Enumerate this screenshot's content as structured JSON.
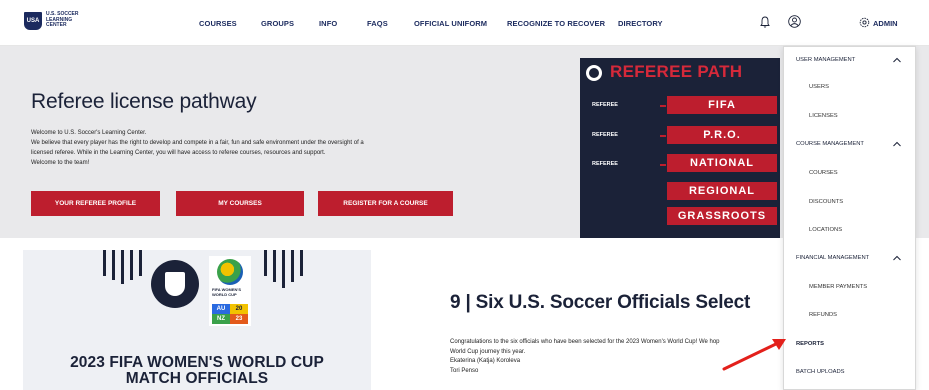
{
  "nav": {
    "logo_text": "U.S. SOCCER LEARNING CENTER",
    "logo_shield": "USA",
    "links": [
      {
        "label": "COURSES"
      },
      {
        "label": "GROUPS"
      },
      {
        "label": "INFO"
      },
      {
        "label": "FAQS"
      },
      {
        "label": "OFFICIAL UNIFORM"
      },
      {
        "label": "RECOGNIZE TO RECOVER"
      },
      {
        "label": "DIRECTORY"
      }
    ],
    "admin_label": "ADMIN",
    "icons": [
      "bell-icon",
      "user-icon",
      "gear-icon"
    ]
  },
  "hero": {
    "title": "Referee license pathway",
    "text_lines": [
      "Welcome to U.S. Soccer's Learning Center.",
      "We believe that every player has the right to develop and compete in a fair, fun and safe environment under the oversight of a",
      "licensed referee. While in the Learning Center, you will have access to referee courses, resources and support.",
      "Welcome to the team!"
    ],
    "buttons": [
      {
        "label": "YOUR REFEREE PROFILE"
      },
      {
        "label": "MY COURSES"
      },
      {
        "label": "REGISTER FOR A COURSE"
      }
    ]
  },
  "pathway": {
    "heading": "REFEREE PATH",
    "rows": [
      {
        "label": "REFEREE",
        "level": "FIFA"
      },
      {
        "label": "REFEREE",
        "level": "P.R.O."
      },
      {
        "label": "REFEREE",
        "level": "NATIONAL"
      },
      {
        "label": "",
        "level": "REGIONAL"
      },
      {
        "label": "",
        "level": "GRASSROOTS"
      }
    ]
  },
  "dropdown": {
    "items": [
      {
        "label": "USER MANAGEMENT",
        "type": "section"
      },
      {
        "label": "USERS",
        "type": "sub"
      },
      {
        "label": "LICENSES",
        "type": "sub"
      },
      {
        "label": "COURSE MANAGEMENT",
        "type": "section"
      },
      {
        "label": "COURSES",
        "type": "sub"
      },
      {
        "label": "DISCOUNTS",
        "type": "sub"
      },
      {
        "label": "LOCATIONS",
        "type": "sub"
      },
      {
        "label": "FINANCIAL MANAGEMENT",
        "type": "section"
      },
      {
        "label": "MEMBER PAYMENTS",
        "type": "sub"
      },
      {
        "label": "REFUNDS",
        "type": "sub"
      },
      {
        "label": "REPORTS",
        "type": "highlight"
      },
      {
        "label": "BATCH UPLOADS",
        "type": "sub"
      }
    ]
  },
  "promo": {
    "title_line1": "2023 FIFA WOMEN'S WORLD CUP",
    "title_line2": "MATCH OFFICIALS",
    "wc_fifa": "FIFA WOMEN'S WORLD CUP",
    "wc_au": "AU",
    "wc_nz": "NZ",
    "wc_20": "20",
    "wc_23": "23"
  },
  "article": {
    "title": "9 | Six U.S. Soccer Officials Select",
    "lines": [
      "Congratulations to the six officials who have been selected for the 2023 Women's World Cup! We hop",
      "World Cup journey this year.",
      "Ekaterina (Katja) Koroleva",
      "Tori Penso"
    ]
  },
  "colors": {
    "brand_navy": "#1b2238",
    "brand_red": "#bd1e2e",
    "hero_bg": "#e9e9eb",
    "annotation_arrow": "#e3201b"
  }
}
